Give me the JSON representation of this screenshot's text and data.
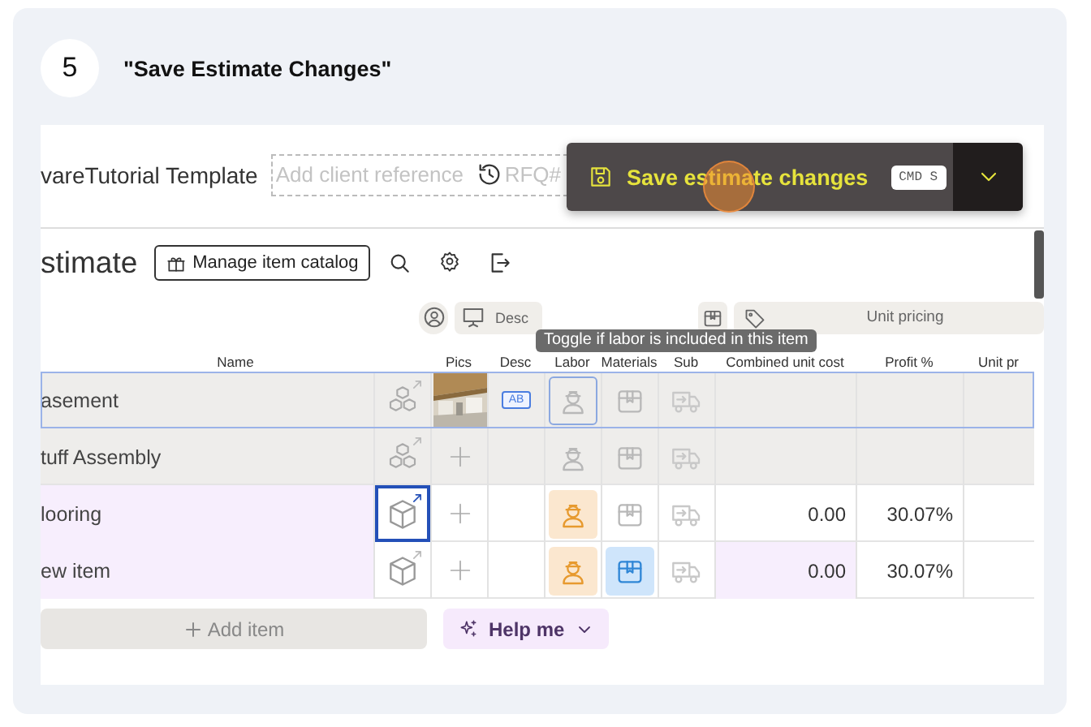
{
  "step": {
    "number": "5",
    "title": "\"Save Estimate Changes\""
  },
  "header": {
    "template_name": "vareTutorial Template",
    "client_reference": {
      "placeholder": "Add client reference",
      "suffix": "RFQ#"
    }
  },
  "save_popup": {
    "label": "Save estimate changes",
    "shortcut": "CMD S"
  },
  "toolbar": {
    "title": "stimate",
    "catalog_button": "Manage item catalog"
  },
  "column_groups": [
    {
      "kind": "details",
      "label": "Desc"
    },
    {
      "kind": "pricing",
      "label": "Unit pricing"
    }
  ],
  "columns": [
    "Name",
    "Pics",
    "Desc",
    "Labor",
    "Materials",
    "Sub",
    "Combined unit cost",
    "Profit %",
    "Unit pr"
  ],
  "tooltip": "Toggle if labor is included in this item",
  "rows": [
    {
      "name": "asement",
      "kind": "assembly",
      "selected": true,
      "type_selected": false,
      "has_photo": true,
      "desc_badge": "AB",
      "labor": false,
      "labor_focused": true,
      "materials": false
    },
    {
      "name": "tuff Assembly",
      "kind": "assembly",
      "selected": false,
      "type_selected": false,
      "has_photo": false,
      "labor": false,
      "labor_focused": false,
      "materials": false
    },
    {
      "name": "looring",
      "kind": "item",
      "selected": false,
      "type_selected": true,
      "has_photo": false,
      "labor": true,
      "labor_focused": false,
      "materials": false,
      "combined_cost": "0.00",
      "profit": "30.07%"
    },
    {
      "name": "ew item",
      "kind": "item",
      "selected": false,
      "type_selected": false,
      "has_photo": false,
      "labor": true,
      "labor_focused": false,
      "materials": true,
      "combined_cost": "0.00",
      "profit": "30.07%"
    }
  ],
  "actions": {
    "add_item": "Add item",
    "help": "Help me"
  }
}
